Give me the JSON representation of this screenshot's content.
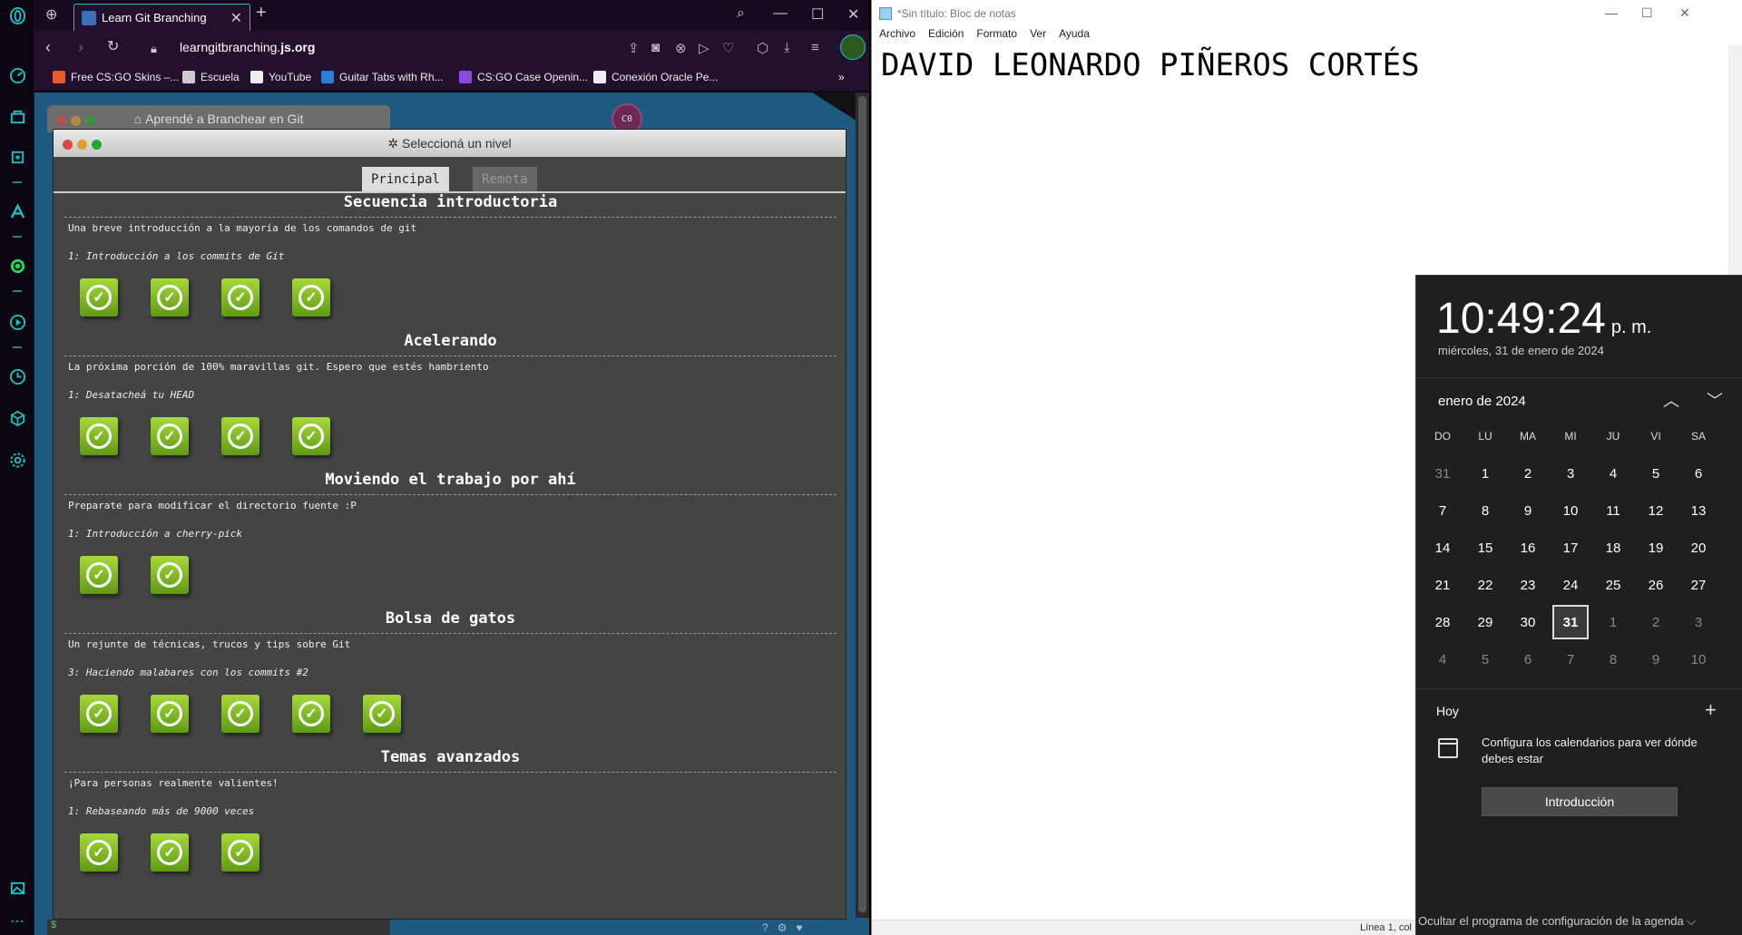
{
  "browser": {
    "tab_title": "Learn Git Branching",
    "url_prefix": "learngitbranching.",
    "url_domain": "js.org",
    "bookmarks": [
      "Free CS:GO Skins –...",
      "Escuela",
      "YouTube",
      "Guitar Tabs with Rh...",
      "CS:GO Case Openin...",
      "Conexión Oracle Pe..."
    ],
    "bookmark_more": "»"
  },
  "game": {
    "bg_window_title": "Aprendé a Branchear en Git",
    "bg_avatar": "C0",
    "dialog_title": "✲ Seleccioná un nivel",
    "tabs": [
      "Principal",
      "Remota"
    ],
    "sections": [
      {
        "title": "Secuencia introductoria",
        "desc": "Una breve introducción a la mayoría de los comandos de git",
        "level": "1: Introducción a los commits de Git",
        "count": 4
      },
      {
        "title": "Acelerando",
        "desc": "La próxima porción de 100% maravillas git. Espero que estés hambriento",
        "level": "1: Desatacheá tu HEAD",
        "count": 4
      },
      {
        "title": "Moviendo el trabajo por ahí",
        "desc": "Preparate para modificar el directorio fuente :P",
        "level": "1: Introducción a cherry-pick",
        "count": 2
      },
      {
        "title": "Bolsa de gatos",
        "desc": "Un rejunte de técnicas, trucos y tips sobre Git",
        "level": "3: Haciendo malabares con los commits #2",
        "count": 5
      },
      {
        "title": "Temas avanzados",
        "desc": "¡Para personas realmente valientes!",
        "level": "1: Rebaseando más de 9000 veces",
        "count": 3
      }
    ],
    "terminal_prompt": "$"
  },
  "notepad": {
    "title": "*Sin título: Bloc de notas",
    "menu": [
      "Archivo",
      "Edición",
      "Formato",
      "Ver",
      "Ayuda"
    ],
    "content": "DAVID LEONARDO PIÑEROS CORTÉS",
    "status": "Línea 1, col"
  },
  "calendar": {
    "time": "10:49:24",
    "ampm": "p. m.",
    "date_long": "miércoles, 31 de enero de 2024",
    "month": "enero de 2024",
    "weekdays": [
      "DO",
      "LU",
      "MA",
      "MI",
      "JU",
      "VI",
      "SA"
    ],
    "days": [
      [
        "31",
        "1",
        "2",
        "3",
        "4",
        "5",
        "6"
      ],
      [
        "7",
        "8",
        "9",
        "10",
        "11",
        "12",
        "13"
      ],
      [
        "14",
        "15",
        "16",
        "17",
        "18",
        "19",
        "20"
      ],
      [
        "21",
        "22",
        "23",
        "24",
        "25",
        "26",
        "27"
      ],
      [
        "28",
        "29",
        "30",
        "31",
        "1",
        "2",
        "3"
      ],
      [
        "4",
        "5",
        "6",
        "7",
        "8",
        "9",
        "10"
      ]
    ],
    "today": "31",
    "agenda_label": "Hoy",
    "agenda_msg": "Configura los calendarios para ver dónde debes estar",
    "intro_button": "Introducción",
    "hide_agenda": "Ocultar el programa de configuración de la agenda ⌵"
  }
}
